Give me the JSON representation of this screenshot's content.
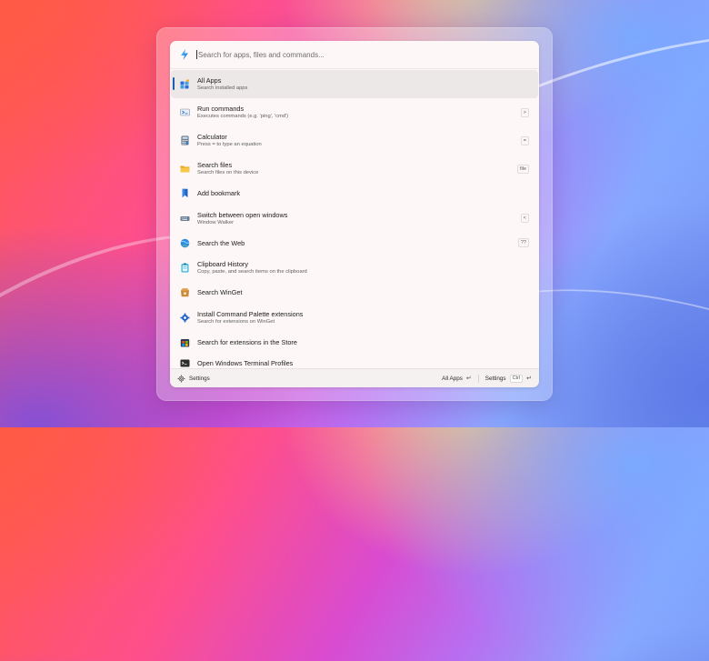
{
  "search": {
    "placeholder": "Search for apps, files and commands..."
  },
  "items": [
    {
      "title": "All Apps",
      "subtitle": "Search installed apps",
      "tag": "",
      "icon": "all-apps-icon"
    },
    {
      "title": "Run commands",
      "subtitle": "Executes commands (e.g. 'ping', 'cmd')",
      "tag": ">",
      "icon": "run-icon"
    },
    {
      "title": "Calculator",
      "subtitle": "Press = to type an equation",
      "tag": "=",
      "icon": "calculator-icon"
    },
    {
      "title": "Search files",
      "subtitle": "Search files on this device",
      "tag": "file",
      "icon": "folder-icon"
    },
    {
      "title": "Add bookmark",
      "subtitle": "",
      "tag": "",
      "icon": "bookmark-icon"
    },
    {
      "title": "Switch between open windows",
      "subtitle": "Window Walker",
      "tag": "<",
      "icon": "window-walker-icon"
    },
    {
      "title": "Search the Web",
      "subtitle": "",
      "tag": "??",
      "icon": "web-search-icon"
    },
    {
      "title": "Clipboard History",
      "subtitle": "Copy, paste, and search items on the clipboard",
      "tag": "",
      "icon": "clipboard-icon"
    },
    {
      "title": "Search WinGet",
      "subtitle": "",
      "tag": "",
      "icon": "winget-icon"
    },
    {
      "title": "Install Command Palette extensions",
      "subtitle": "Search for extensions on WinGet",
      "tag": "",
      "icon": "extension-gear-icon"
    },
    {
      "title": "Search for extensions in the Store",
      "subtitle": "",
      "tag": "",
      "icon": "store-icon"
    },
    {
      "title": "Open Windows Terminal Profiles",
      "subtitle": "",
      "tag": "",
      "icon": "terminal-icon"
    }
  ],
  "footer": {
    "settings_label": "Settings",
    "primary_action": "All Apps",
    "primary_key": "↵",
    "secondary_action": "Settings",
    "secondary_key_mod": "Ctrl",
    "secondary_key": "↵"
  },
  "colors": {
    "selection_accent": "#1a5fb4",
    "palette_background": "#fdf8f7"
  }
}
